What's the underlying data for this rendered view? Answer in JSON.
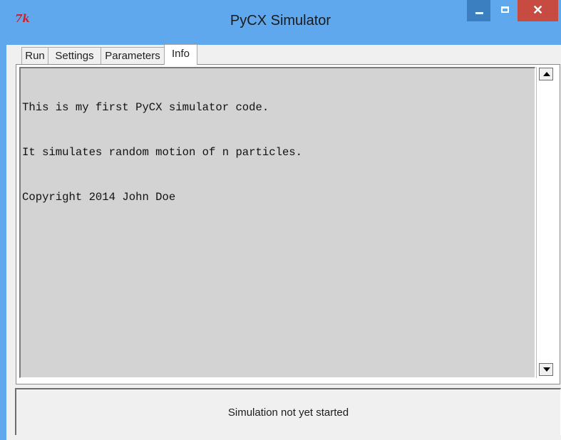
{
  "window": {
    "title": "PyCX Simulator",
    "logo_text": "7k",
    "close_glyph": "✕"
  },
  "tabs": [
    {
      "label": "Run",
      "active": false
    },
    {
      "label": "Settings",
      "active": false
    },
    {
      "label": "Parameters",
      "active": false
    },
    {
      "label": "Info",
      "active": true
    }
  ],
  "info": {
    "lines": [
      "This is my first PyCX simulator code.",
      "It simulates random motion of n particles.",
      "Copyright 2014 John Doe"
    ]
  },
  "status": {
    "text": "Simulation not yet started"
  },
  "icons": {
    "app": "tk-logo-icon",
    "minimize": "minimize-icon",
    "maximize": "maximize-icon",
    "close": "close-icon",
    "scroll_up": "arrow-up-icon",
    "scroll_down": "arrow-down-icon"
  },
  "colors": {
    "titlebar": "#5fa8ee",
    "close_button": "#c74b40",
    "text_area": "#d3d3d3"
  }
}
